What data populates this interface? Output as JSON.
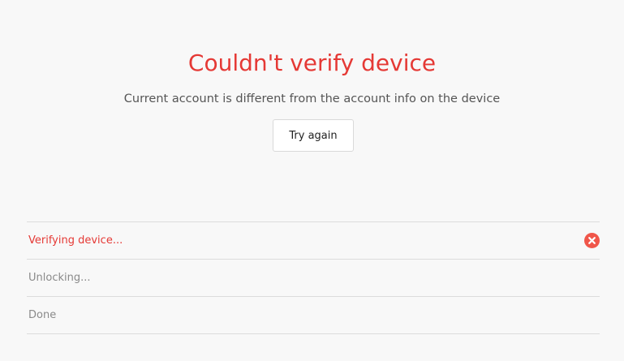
{
  "header": {
    "title": "Couldn't verify device",
    "subtitle": "Current account is different from the account info on the device"
  },
  "actions": {
    "retry_label": "Try again"
  },
  "steps": [
    {
      "label": "Verifying device...",
      "state": "error",
      "icon": "error-x-icon"
    },
    {
      "label": "Unlocking...",
      "state": "pending"
    },
    {
      "label": "Done",
      "state": "pending"
    }
  ],
  "colors": {
    "error": "#e53935",
    "error_icon": "#f0564a",
    "muted": "#8a8a8a",
    "background": "#f8f8f8"
  }
}
